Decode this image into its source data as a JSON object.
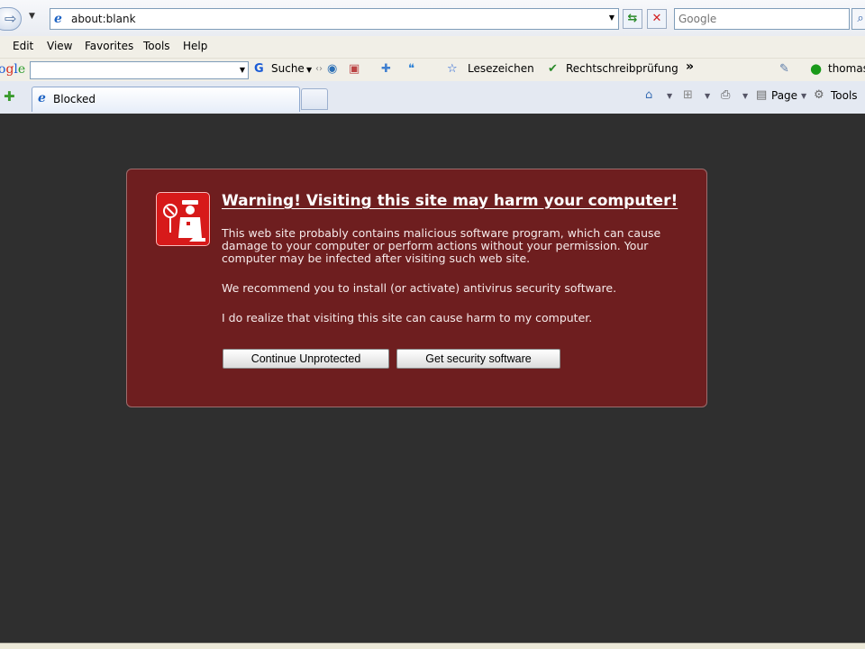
{
  "browser": {
    "address_url": "about:blank",
    "search_placeholder": "Google",
    "menu": [
      "Edit",
      "View",
      "Favorites",
      "Tools",
      "Help"
    ],
    "google_toolbar": {
      "logo_text": "ogle",
      "search_label": "Suche",
      "bookmarks_label": "Lesezeichen",
      "spellcheck_label": "Rechtschreibprüfung",
      "more_label": "»",
      "user_label": "thomas"
    },
    "tab": {
      "title": "Blocked"
    },
    "command_bar": {
      "page_label": "Page",
      "tools_label": "Tools"
    }
  },
  "warning": {
    "headline": "Warning! Visiting this site may harm your computer!",
    "paragraph1": "This web site probably contains malicious software program, which can cause damage to your computer or perform actions without your permission. Your computer may be infected after visiting such web site.",
    "paragraph2": "We recommend you to install (or activate) antivirus security software.",
    "paragraph3": "I do realize that visiting this site can cause harm to my computer.",
    "button_continue": "Continue Unprotected",
    "button_get": "Get security software"
  },
  "colors": {
    "background": "#2f2f2f",
    "panel": "#6e1e1f",
    "shield": "#d71a1a"
  }
}
